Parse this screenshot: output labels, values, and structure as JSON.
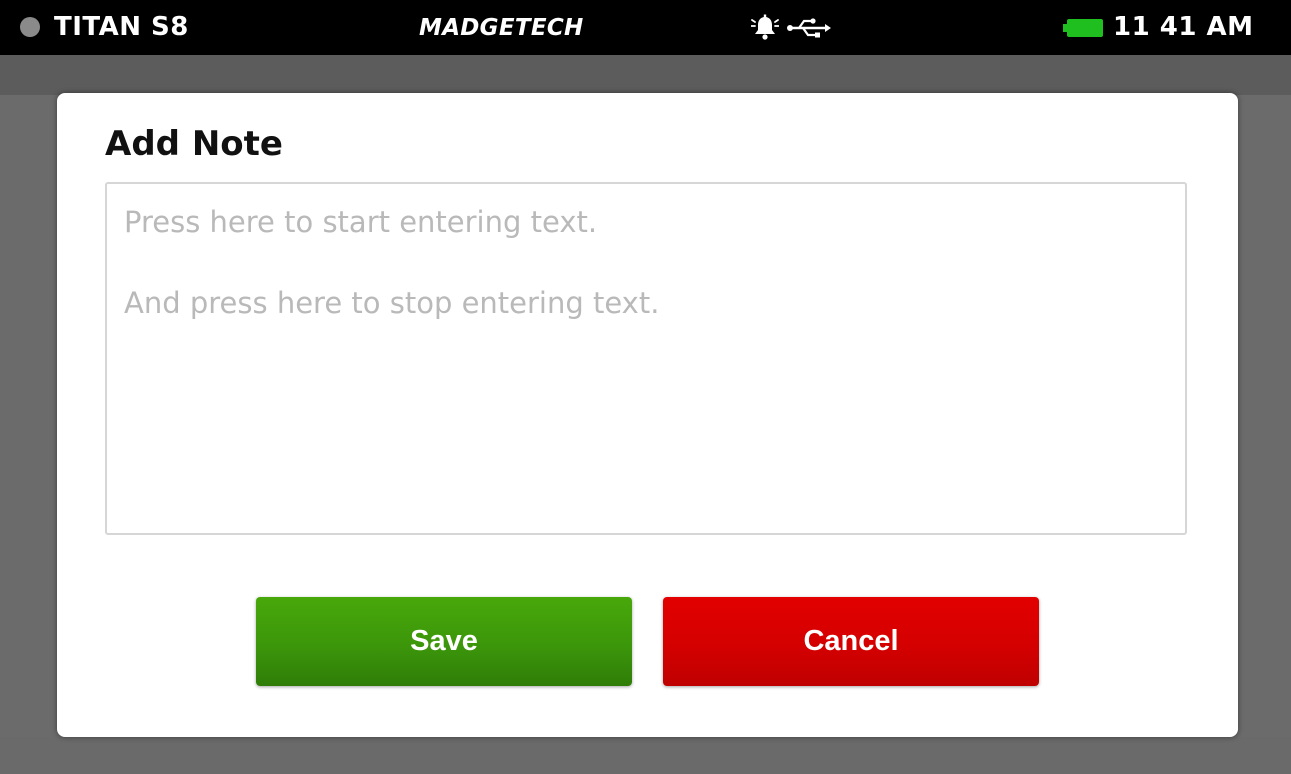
{
  "status_bar": {
    "device_name": "TITAN S8",
    "brand": "MADGETECH",
    "time": "11 41 AM",
    "icons": {
      "status_dot": "status-dot-icon",
      "alarm": "alarm-bell-icon",
      "usb": "usb-icon",
      "battery": "battery-icon"
    },
    "battery_color": "#1fbf1f"
  },
  "dialog": {
    "title": "Add Note",
    "note_field": {
      "hint_start": "Press here to start entering text.",
      "hint_stop": "And press here to stop entering text.",
      "value": ""
    },
    "save_label": "Save",
    "cancel_label": "Cancel"
  },
  "colors": {
    "save": "#3c960a",
    "cancel": "#d40000",
    "status_bar": "#000000",
    "backdrop": "#6b6b6b"
  }
}
